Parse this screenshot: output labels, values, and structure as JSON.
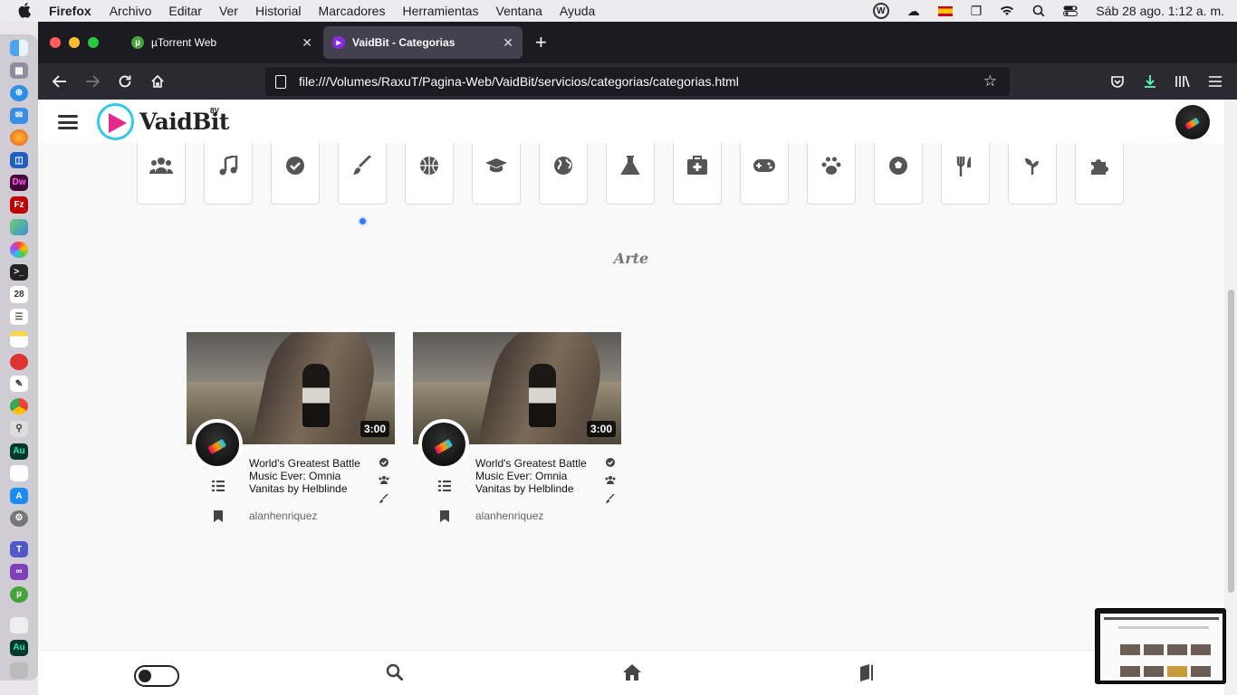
{
  "menubar": {
    "app": "Firefox",
    "items": [
      "Archivo",
      "Editar",
      "Ver",
      "Historial",
      "Marcadores",
      "Herramientas",
      "Ventana",
      "Ayuda"
    ],
    "clock": "Sáb 28 ago.  1:12 a. m."
  },
  "tabs": [
    {
      "title": "µTorrent Web",
      "icon": "utorrent-icon"
    },
    {
      "title": "VaidBit - Categorias",
      "icon": "vaidbit-icon"
    }
  ],
  "url": "file:///Volumes/RaxuT/Pagina-Web/VaidBit/servicios/categorias/categorias.html",
  "site": {
    "name": "VaidBit",
    "sup": "8V"
  },
  "categories": [
    {
      "icon": "users-icon",
      "glyph": "👥"
    },
    {
      "icon": "music-icon",
      "glyph": "♫"
    },
    {
      "icon": "check-circle-icon",
      "glyph": "✔"
    },
    {
      "icon": "paintbrush-icon",
      "glyph": "🖌"
    },
    {
      "icon": "basketball-icon",
      "glyph": "⚾"
    },
    {
      "icon": "graduation-cap-icon",
      "glyph": "🎓"
    },
    {
      "icon": "globe-icon",
      "glyph": "🌍"
    },
    {
      "icon": "flask-icon",
      "glyph": "⚗"
    },
    {
      "icon": "medkit-icon",
      "glyph": "✚"
    },
    {
      "icon": "gamepad-icon",
      "glyph": "🎮"
    },
    {
      "icon": "paw-icon",
      "glyph": "🐾"
    },
    {
      "icon": "soccer-ball-icon",
      "glyph": "⚽"
    },
    {
      "icon": "utensils-icon",
      "glyph": "🍴"
    },
    {
      "icon": "seedling-icon",
      "glyph": "🌱"
    },
    {
      "icon": "puzzle-icon",
      "glyph": "🧩"
    }
  ],
  "section_title": "Arte",
  "videos": [
    {
      "duration": "3:00",
      "title": "World's Greatest Battle Music Ever: Omnia Vanitas by Helblinde",
      "author": "alanhenriquez"
    },
    {
      "duration": "3:00",
      "title": "World's Greatest Battle Music Ever: Omnia Vanitas by Helblinde",
      "author": "alanhenriquez"
    }
  ],
  "colors": {
    "accent": "#36c6e8",
    "brand_pink": "#e52a8e",
    "focus_dot": "#2f7cf6"
  }
}
